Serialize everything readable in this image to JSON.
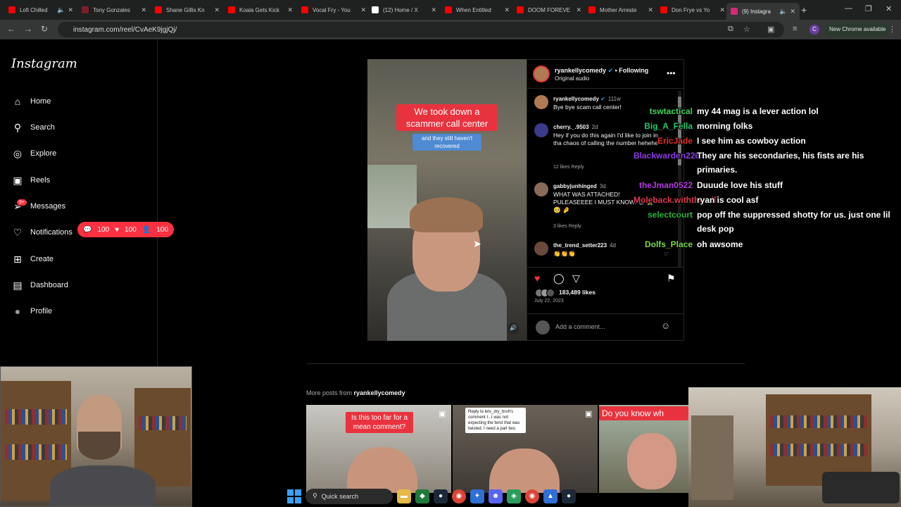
{
  "browser": {
    "tabs": [
      {
        "label": "Lofi Chilled",
        "color": "#ff0000"
      },
      {
        "label": "Tony Gonzales",
        "color": "#7a1f2a"
      },
      {
        "label": "Shane Gillis Kn",
        "color": "#ff0000"
      },
      {
        "label": "Koala Gets Kick",
        "color": "#ff0000"
      },
      {
        "label": "Vocal Fry - You",
        "color": "#ff0000"
      },
      {
        "label": "(12) Home / X",
        "color": "#ffffff"
      },
      {
        "label": "When Entitled",
        "color": "#ff0000"
      },
      {
        "label": "DOOM FOREVE",
        "color": "#ff0000"
      },
      {
        "label": "Mother Arreste",
        "color": "#ff0000"
      },
      {
        "label": "Don Frye vs Yo",
        "color": "#ff0000"
      },
      {
        "label": "(9) Instagra",
        "color": "#d62976",
        "active": true
      }
    ],
    "url": "instagram.com/reel/CvAeK9jgjQj/",
    "profile_initial": "C",
    "chrome_available": "New Chrome available"
  },
  "sidebar": {
    "logo": "Instagram",
    "items": [
      {
        "label": "Home",
        "icon": "home-icon",
        "glyph": "⌂"
      },
      {
        "label": "Search",
        "icon": "search-icon",
        "glyph": "⚲"
      },
      {
        "label": "Explore",
        "icon": "compass-icon",
        "glyph": "◎"
      },
      {
        "label": "Reels",
        "icon": "reels-icon",
        "glyph": "▣"
      },
      {
        "label": "Messages",
        "icon": "messages-icon",
        "glyph": "➢"
      },
      {
        "label": "Notifications",
        "icon": "heart-icon",
        "glyph": "♡"
      },
      {
        "label": "Create",
        "icon": "plus-square-icon",
        "glyph": "⊞"
      },
      {
        "label": "Dashboard",
        "icon": "dashboard-icon",
        "glyph": "▤"
      },
      {
        "label": "Profile",
        "icon": "profile-avatar-icon",
        "glyph": "●"
      }
    ],
    "messages_badge": "9+",
    "notifications": {
      "comments": "100",
      "likes": "100",
      "follows": "100"
    }
  },
  "post": {
    "video_caption_main": "We took down a scammer call center",
    "video_caption_sub": "and they still haven't recovered",
    "username": "ryankellycomedy",
    "following": "• Following",
    "audio": "Original audio",
    "comments": [
      {
        "user": "ryankellycomedy",
        "time": "111w",
        "text": "Bye bye scam call center!",
        "meta": "",
        "avatar": "#b07a55"
      },
      {
        "user": "cherry._.9503",
        "time": "2d",
        "text": "Hey if you do this again I'd like to join in tha chaos of calling the number hehehe",
        "meta": "12 likes   Reply",
        "avatar": "#3b3b8a"
      },
      {
        "user": "gabbyjunhinged",
        "time": "3d",
        "text": "WHAT WAS ATTACHED! PULEASEEEE I MUST KNOW! 😵 🙏 🥺 🤌",
        "meta": "3 likes   Reply",
        "avatar": "#8a6a5a"
      },
      {
        "user": "the_trend_setter223",
        "time": "4d",
        "text": "👏👏👏",
        "meta": "",
        "avatar": "#6a4a3a"
      }
    ],
    "likes": "183,489 likes",
    "date": "July 22, 2023",
    "add_comment_placeholder": "Add a comment..."
  },
  "chat": [
    {
      "user": "tswtactical",
      "color": "#3fd35a",
      "msg": "my 44 mag is a lever action lol"
    },
    {
      "user": "Big_A_Fella",
      "color": "#22c66b",
      "msg": "morning folks"
    },
    {
      "user": "EricJade",
      "color": "#e0302a",
      "msg": "I see him as cowboy action"
    },
    {
      "user": "Blackwarden226",
      "color": "#8a3ce0",
      "msg": "They are his secondaries, his fists are his primaries."
    },
    {
      "user": "theJman0522",
      "color": "#b43be0",
      "msg": "Duuude love his stuff"
    },
    {
      "user": "Moleback.withthemilk",
      "color": "#e03a4e",
      "msg": "ryan is cool asf"
    },
    {
      "user": "selectcourt",
      "color": "#2fb344",
      "msg": "pop off the suppressed shotty for us. just one lil desk pop"
    },
    {
      "user": "Dolfs_Place",
      "color": "#7ad84a",
      "msg": "oh awsome"
    }
  ],
  "more_posts": {
    "prefix": "More posts from",
    "user": "ryankellycomedy",
    "thumbs": [
      {
        "caption": "Is this too far for a mean comment?"
      },
      {
        "caption": "Reply to lets_dry_bruh's comment I...I was not expecting the twist that was twisted. I need a part two."
      },
      {
        "caption": "Do you know wh"
      }
    ]
  },
  "taskbar": {
    "search_label": "Quick search"
  }
}
